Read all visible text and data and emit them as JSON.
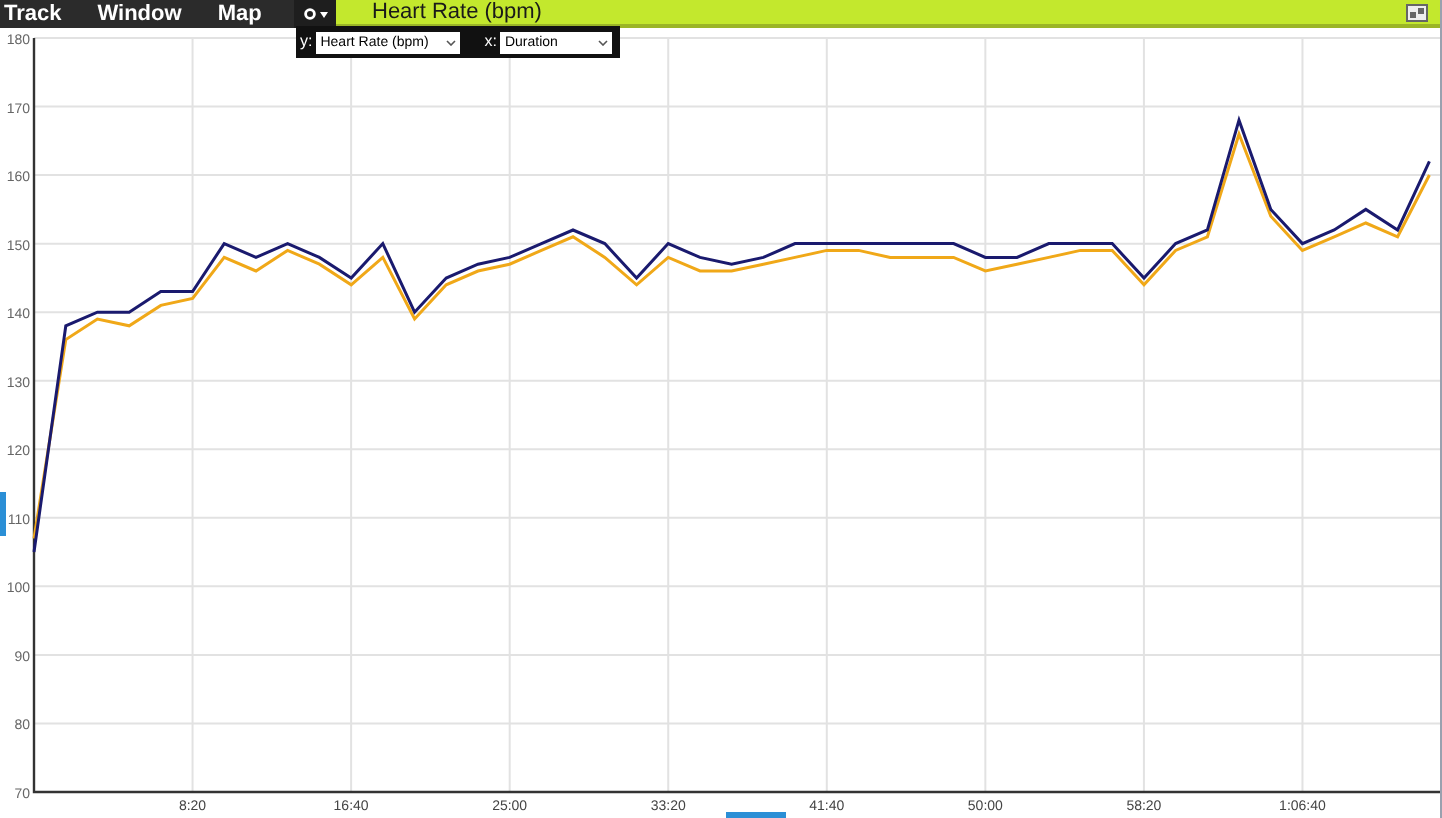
{
  "menu": [
    {
      "label": "Track"
    },
    {
      "label": "Window"
    },
    {
      "label": "Map"
    }
  ],
  "panel": {
    "title": "Heart Rate (bpm)",
    "axis_picker": {
      "y_label": "y:",
      "y_value": "Heart Rate (bpm)",
      "x_label": "x:",
      "x_value": "Duration"
    },
    "chart_data": {
      "type": "line",
      "x": [
        0,
        100,
        200,
        300,
        400,
        500,
        600,
        700,
        800,
        900,
        1000,
        1100,
        1200,
        1300,
        1400,
        1500,
        1600,
        1700,
        1800,
        1900,
        2000,
        2100,
        2200,
        2300,
        2400,
        2500,
        2600,
        2700,
        2800,
        2900,
        3000,
        3100,
        3200,
        3300,
        3400,
        3500,
        3600,
        3700,
        3800,
        3900,
        4000,
        4100,
        4200,
        4300,
        4400
      ],
      "series": [
        {
          "color": "#f0a818",
          "values": [
            107,
            136,
            139,
            138,
            141,
            142,
            148,
            146,
            149,
            147,
            144,
            148,
            139,
            144,
            146,
            147,
            149,
            151,
            148,
            144,
            148,
            146,
            146,
            147,
            148,
            149,
            149,
            148,
            148,
            148,
            146,
            147,
            148,
            149,
            149,
            144,
            149,
            151,
            166,
            154,
            149,
            151,
            153,
            151,
            160
          ]
        },
        {
          "color": "#1a1a6e",
          "values": [
            105,
            138,
            140,
            140,
            143,
            143,
            150,
            148,
            150,
            148,
            145,
            150,
            140,
            145,
            147,
            148,
            150,
            152,
            150,
            145,
            150,
            148,
            147,
            148,
            150,
            150,
            150,
            150,
            150,
            150,
            148,
            148,
            150,
            150,
            150,
            145,
            150,
            152,
            168,
            155,
            150,
            152,
            155,
            152,
            162
          ]
        }
      ],
      "grid": true,
      "xlim": [
        0,
        4440
      ],
      "ylim": [
        70,
        180
      ],
      "xticks": [
        {
          "value": 500,
          "label": "8:20"
        },
        {
          "value": 1000,
          "label": "16:40"
        },
        {
          "value": 1500,
          "label": "25:00"
        },
        {
          "value": 2000,
          "label": "33:20"
        },
        {
          "value": 2500,
          "label": "41:40"
        },
        {
          "value": 3000,
          "label": "50:00"
        },
        {
          "value": 3500,
          "label": "58:20"
        },
        {
          "value": 4000,
          "label": "1:06:40"
        }
      ],
      "yticks": [
        70,
        80,
        90,
        100,
        110,
        120,
        130,
        140,
        150,
        160,
        170,
        180
      ]
    }
  }
}
